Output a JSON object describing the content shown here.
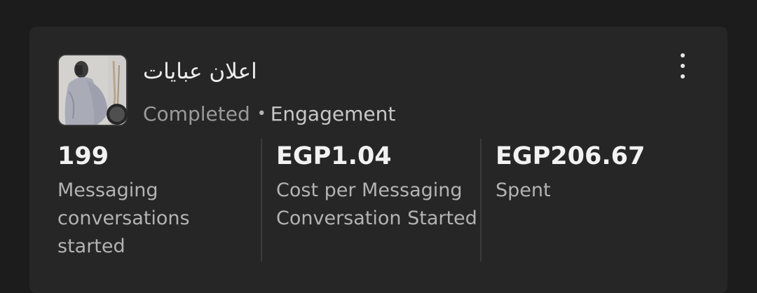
{
  "ad": {
    "title": "اعلان عبايات",
    "status": "Completed",
    "separator": "•",
    "objective": "Engagement"
  },
  "metrics": [
    {
      "value": "199",
      "label": "Messaging conversations started"
    },
    {
      "value": "EGP1.04",
      "label": "Cost per Messaging Conversation Started"
    },
    {
      "value": "EGP206.67",
      "label": "Spent"
    }
  ],
  "icons": {
    "more": "more-vertical-icon",
    "status": "status-dot-icon"
  },
  "colors": {
    "background": "#1c1c1c",
    "card": "#262626",
    "status_dot": "#4f4f4f"
  }
}
